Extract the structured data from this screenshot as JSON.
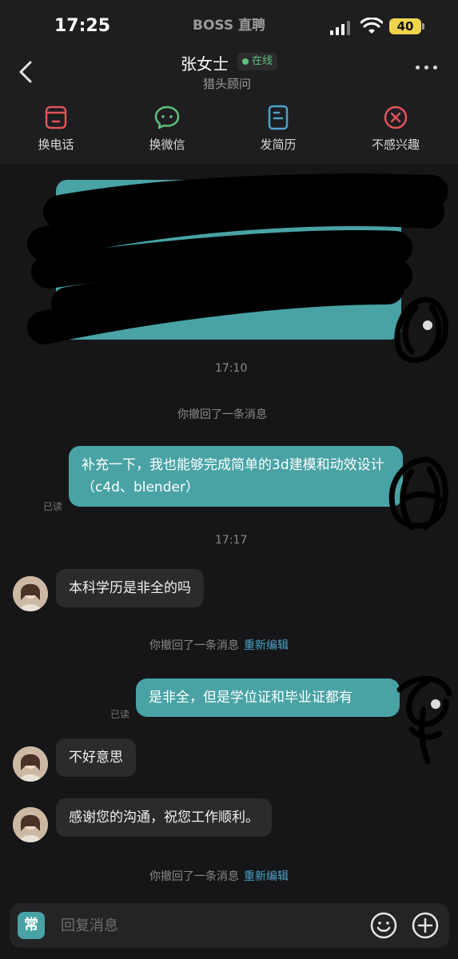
{
  "status_bar": {
    "time": "17:25",
    "app_name": "BOSS 直聘",
    "battery": "40"
  },
  "header": {
    "back_icon": "chevron-left-icon",
    "name": "张女士",
    "online_label": "在线",
    "role": "猎头顾问",
    "more_icon": "more-dots-icon"
  },
  "actions": [
    {
      "label": "换电话",
      "icon": "phone-swap-icon",
      "color": "#e0545a"
    },
    {
      "label": "换微信",
      "icon": "wechat-icon",
      "color": "#5ec27a"
    },
    {
      "label": "发简历",
      "icon": "resume-icon",
      "color": "#4aa3c9"
    },
    {
      "label": "不感兴趣",
      "icon": "not-interested-icon",
      "color": "#e0545a"
    }
  ],
  "chat": {
    "time_1": "17:10",
    "recall_1": "你撤回了一条消息",
    "msg_out_1": "补充一下，我也能够完成简单的3d建模和动效设计（c4d、blender）",
    "read_1": "已读",
    "time_2": "17:17",
    "msg_in_1": "本科学历是非全的吗",
    "recall_2": "你撤回了一条消息",
    "re_edit_2": "重新编辑",
    "msg_out_2": "是非全，但是学位证和毕业证都有",
    "read_2": "已读",
    "msg_in_2": "不好意思",
    "msg_in_3": "感谢您的沟通，祝您工作顺利。",
    "recall_3": "你撤回了一条消息",
    "re_edit_3": "重新编辑"
  },
  "input_bar": {
    "common_label": "常",
    "placeholder": "回复消息",
    "emoji_icon": "emoji-icon",
    "plus_icon": "plus-icon"
  },
  "colors": {
    "accent": "#49a3a5",
    "online": "#5ec27a",
    "link": "#4aa3c9",
    "background": "#161618"
  }
}
